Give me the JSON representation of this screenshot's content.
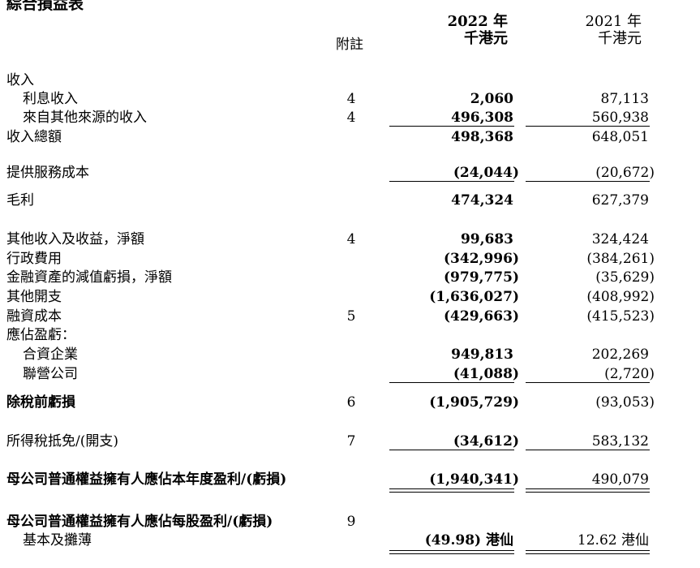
{
  "statement": {
    "title": "綜合損益表",
    "columns": {
      "note": "附註",
      "year_current": "2022 年",
      "unit_current": "千港元",
      "year_prior": "2021 年",
      "unit_prior": "千港元"
    },
    "rows": [
      {
        "label": "收入",
        "note": "",
        "v2022": "",
        "v2021": ""
      },
      {
        "label": "利息收入",
        "note": "4",
        "v2022": "2,060",
        "v2021": "87,113"
      },
      {
        "label": "來自其他來源的收入",
        "note": "4",
        "v2022": "496,308",
        "v2021": "560,938"
      },
      {
        "label": "收入總額",
        "note": "",
        "v2022": "498,368",
        "v2021": "648,051"
      },
      {
        "label": "提供服務成本",
        "note": "",
        "v2022": "(24,044)",
        "v2021": "(20,672)"
      },
      {
        "label": "毛利",
        "note": "",
        "v2022": "474,324",
        "v2021": "627,379"
      },
      {
        "label": "其他收入及收益，淨額",
        "note": "4",
        "v2022": "99,683",
        "v2021": "324,424"
      },
      {
        "label": "行政費用",
        "note": "",
        "v2022": "(342,996)",
        "v2021": "(384,261)"
      },
      {
        "label": "金融資產的減值虧損，淨額",
        "note": "",
        "v2022": "(979,775)",
        "v2021": "(35,629)"
      },
      {
        "label": "其他開支",
        "note": "",
        "v2022": "(1,636,027)",
        "v2021": "(408,992)"
      },
      {
        "label": "融資成本",
        "note": "5",
        "v2022": "(429,663)",
        "v2021": "(415,523)"
      },
      {
        "label": "應佔盈虧：",
        "note": "",
        "v2022": "",
        "v2021": ""
      },
      {
        "label": "合資企業",
        "note": "",
        "v2022": "949,813",
        "v2021": "202,269"
      },
      {
        "label": "聯營公司",
        "note": "",
        "v2022": "(41,088)",
        "v2021": "(2,720)"
      },
      {
        "label": "除稅前虧損",
        "note": "6",
        "v2022": "(1,905,729)",
        "v2021": "(93,053)"
      },
      {
        "label": "所得稅抵免/(開支)",
        "note": "7",
        "v2022": "(34,612)",
        "v2021": "583,132"
      },
      {
        "label": "母公司普通權益擁有人應佔本年度盈利/(虧損)",
        "note": "",
        "v2022": "(1,940,341)",
        "v2021": "490,079"
      },
      {
        "label": "母公司普通權益擁有人應佔每股盈利/(虧損)",
        "note": "9",
        "v2022": "",
        "v2021": ""
      },
      {
        "label": "基本及攤薄",
        "note": "",
        "v2022": "(49.98) 港仙",
        "v2021": "12.62 港仙"
      }
    ]
  }
}
